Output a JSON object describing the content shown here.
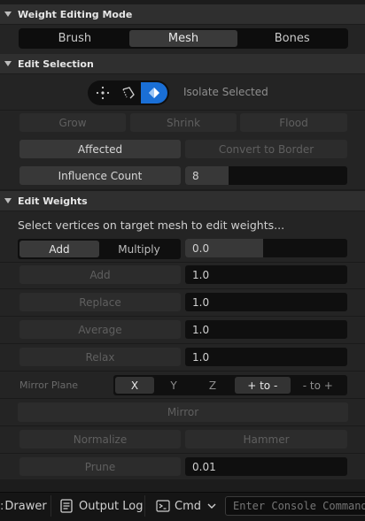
{
  "weight_mode": {
    "title": "Weight Editing Mode",
    "tabs": [
      "Brush",
      "Mesh",
      "Bones"
    ],
    "selected": "Mesh"
  },
  "edit_selection": {
    "title": "Edit Selection",
    "tool_icons": [
      "vertex-select-icon",
      "lasso-select-icon",
      "face-select-icon"
    ],
    "active_tool": "face-select-icon",
    "isolate_label": "Isolate Selected",
    "grow": "Grow",
    "shrink": "Shrink",
    "flood": "Flood",
    "affected": "Affected",
    "convert_to_border": "Convert to Border",
    "influence_label": "Influence Count",
    "influence_value": "8",
    "influence_fraction": 0.27
  },
  "edit_weights": {
    "title": "Edit Weights",
    "hint": "Select vertices on target mesh to edit weights...",
    "mode_add": "Add",
    "mode_multiply": "Multiply",
    "mode_value": "0.0",
    "mode_value_fraction": 0.48,
    "add": "Add",
    "add_value": "1.0",
    "replace": "Replace",
    "replace_value": "1.0",
    "average": "Average",
    "average_value": "1.0",
    "relax": "Relax",
    "relax_value": "1.0",
    "mirror_plane_label": "Mirror Plane",
    "axes": [
      "X",
      "Y",
      "Z"
    ],
    "dir_pos_to_neg": "+ to -",
    "dir_neg_to_pos": "- to +",
    "mirror": "Mirror",
    "normalize": "Normalize",
    "hammer": "Hammer",
    "prune": "Prune",
    "prune_value": "0.01"
  },
  "bottom_bar": {
    "drawer": "Drawer",
    "output_log": "Output Log",
    "cmd": "Cmd",
    "console_placeholder": "Enter Console Command"
  },
  "colors": {
    "accent": "#1a6fd6",
    "panel": "#242424",
    "header": "#2f2f2f"
  }
}
